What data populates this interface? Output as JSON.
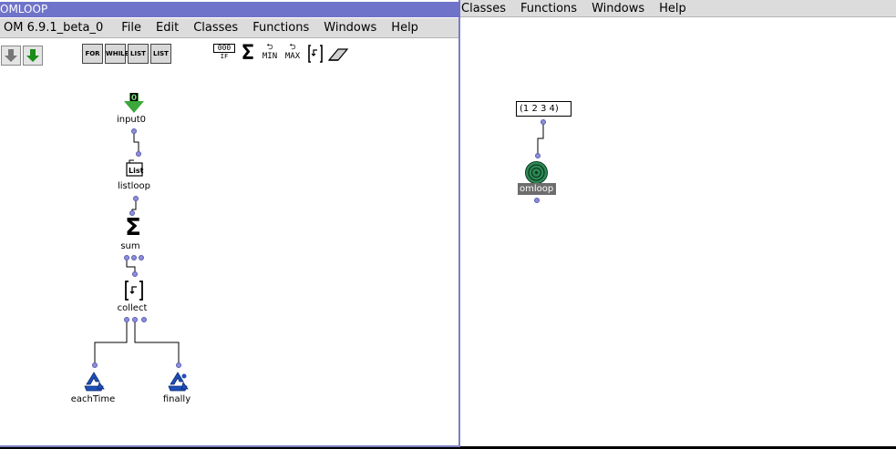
{
  "background_window": {
    "menu": [
      "Classes",
      "Functions",
      "Windows",
      "Help"
    ],
    "patch": {
      "input_box_value": "(1 2 3 4)",
      "box_label": "omloop"
    }
  },
  "front_window": {
    "title": "OMLOOP",
    "menu": [
      "OM 6.9.1_beta_0",
      "File",
      "Edit",
      "Classes",
      "Functions",
      "Windows",
      "Help"
    ],
    "toolbar": {
      "loop_boxes": [
        "FOR",
        "WHILE",
        "LIST",
        "LIST"
      ],
      "tools": [
        "IF",
        "Σ",
        "MIN",
        "MAX"
      ]
    },
    "patch": {
      "input_value": "0",
      "input_label": "input0",
      "listloop_label": "listloop",
      "sum_label": "sum",
      "collect_label": "collect",
      "eachtime_label": "eachTime",
      "finally_label": "finally"
    }
  },
  "colors": {
    "title_bar": "#6f73c9",
    "port": "#8d8fd8",
    "omloop_label_bg": "#6d6d6d",
    "input_arrow": "#3aa83a",
    "recycle": "#1f4fb8"
  }
}
